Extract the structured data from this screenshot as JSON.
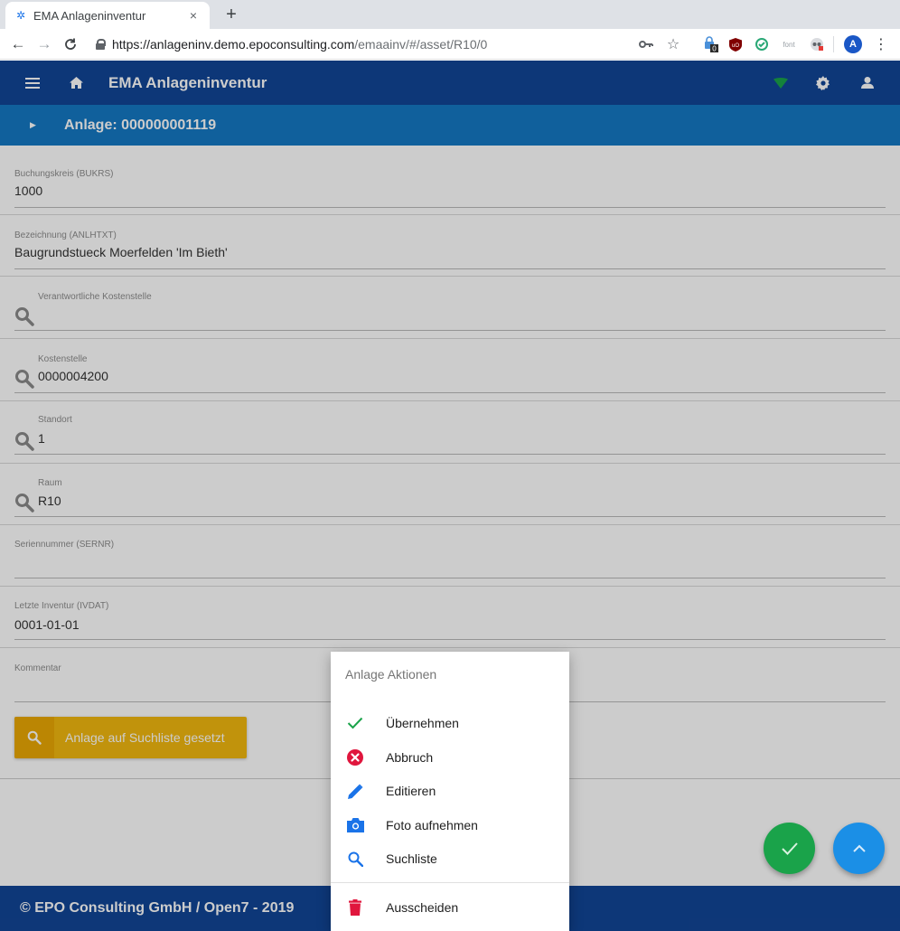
{
  "browser": {
    "tab_title": "EMA Anlageninventur",
    "tab_close": "×",
    "new_tab": "+",
    "url_host": "https://anlageninv.demo.epoconsulting.com",
    "url_path": "/emaainv/#/asset/R10/0",
    "extension_badge": "0",
    "ext_font_label": "font",
    "profile_initial": "A"
  },
  "app": {
    "title": "EMA Anlageninventur",
    "asset_header": "Anlage: 000000001119"
  },
  "fields": [
    {
      "label": "Buchungskreis (BUKRS)",
      "value": "1000"
    },
    {
      "label": "Bezeichnung (ANLHTXT)",
      "value": "Baugrundstueck Moerfelden 'Im Bieth'"
    },
    {
      "label": "Verantwortliche Kostenstelle",
      "value": ""
    },
    {
      "label": "Kostenstelle",
      "value": "0000004200"
    },
    {
      "label": "Standort",
      "value": "1"
    },
    {
      "label": "Raum",
      "value": "R10"
    },
    {
      "label": "Seriennummer (SERNR)",
      "value": ""
    },
    {
      "label": "Letzte Inventur (IVDAT)",
      "value": "0001-01-01"
    },
    {
      "label": "Kommentar",
      "value": ""
    }
  ],
  "search_button": {
    "label": "Anlage auf Suchliste gesetzt"
  },
  "footer": {
    "text": "© EPO Consulting GmbH / Open7 - 2019"
  },
  "action_sheet": {
    "title": "Anlage Aktionen",
    "items": [
      {
        "label": "Übernehmen",
        "icon": "check-icon",
        "color": "#1aa34a"
      },
      {
        "label": "Abbruch",
        "icon": "cancel-circle-icon",
        "color": "#e0163d"
      },
      {
        "label": "Editieren",
        "icon": "pencil-icon",
        "color": "#1a73e8"
      },
      {
        "label": "Foto aufnehmen",
        "icon": "camera-icon",
        "color": "#1a73e8"
      },
      {
        "label": "Suchliste",
        "icon": "search-icon",
        "color": "#1a73e8"
      },
      {
        "label": "Ausscheiden",
        "icon": "trash-icon",
        "color": "#e0163d"
      }
    ]
  },
  "colors": {
    "appbar": "#114596",
    "subbar": "#1578c4",
    "search_button": "#f2b80f",
    "fab_ok": "#1aa34a",
    "fab_up": "#1b8fe6",
    "wifi_indicator": "#1aa34a"
  }
}
